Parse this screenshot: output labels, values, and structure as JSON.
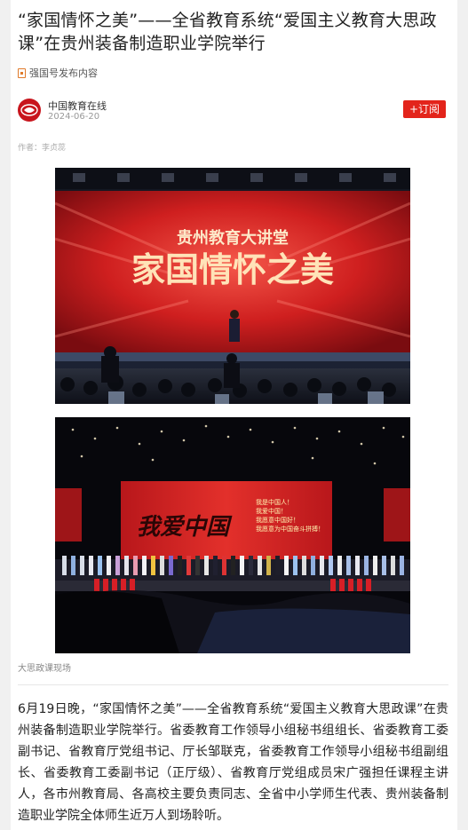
{
  "article": {
    "title": "“家国情怀之美”——全省教育系统“爱国主义教育大思政课”在贵州装备制造职业学院举行",
    "source_note": "强国号发布内容",
    "author_name": "中国教育在线",
    "publish_date": "2024-06-20",
    "subscribe_label": "+订阅",
    "byline": "作者：李贞蕊",
    "photo1_banner_small": "贵州教育大讲堂",
    "photo1_banner_large": "家国情怀之美",
    "photo2_banner_title": "我爱中国",
    "photo2_screen_lines": [
      "我是中国人！",
      "我爱中国！",
      "我愿意中国好！",
      "我愿意为中国奋斗拼搏！"
    ],
    "photo_caption": "大思政课现场",
    "body": "6月19日晚，“家国情怀之美”——全省教育系统“爱国主义教育大思政课”在贵州装备制造职业学院举行。省委教育工作领导小组秘书组组长、省委教育工委副书记、省教育厅党组书记、厅长邹联克，省委教育工作领导小组秘书组副组长、省委教育工委副书记（正厅级）、省教育厅党组成员宋广强担任课程主讲人，各市州教育局、各高校主要负责同志、全省中小学师生代表、贵州装备制造职业学院全体师生近万人到场聆听。"
  },
  "colors": {
    "accent": "#e3241b",
    "avatar_bg": "#c8151d",
    "stage_red": "#c81e1e"
  },
  "icons": {
    "source": "document-icon",
    "avatar": "media-logo-icon"
  }
}
